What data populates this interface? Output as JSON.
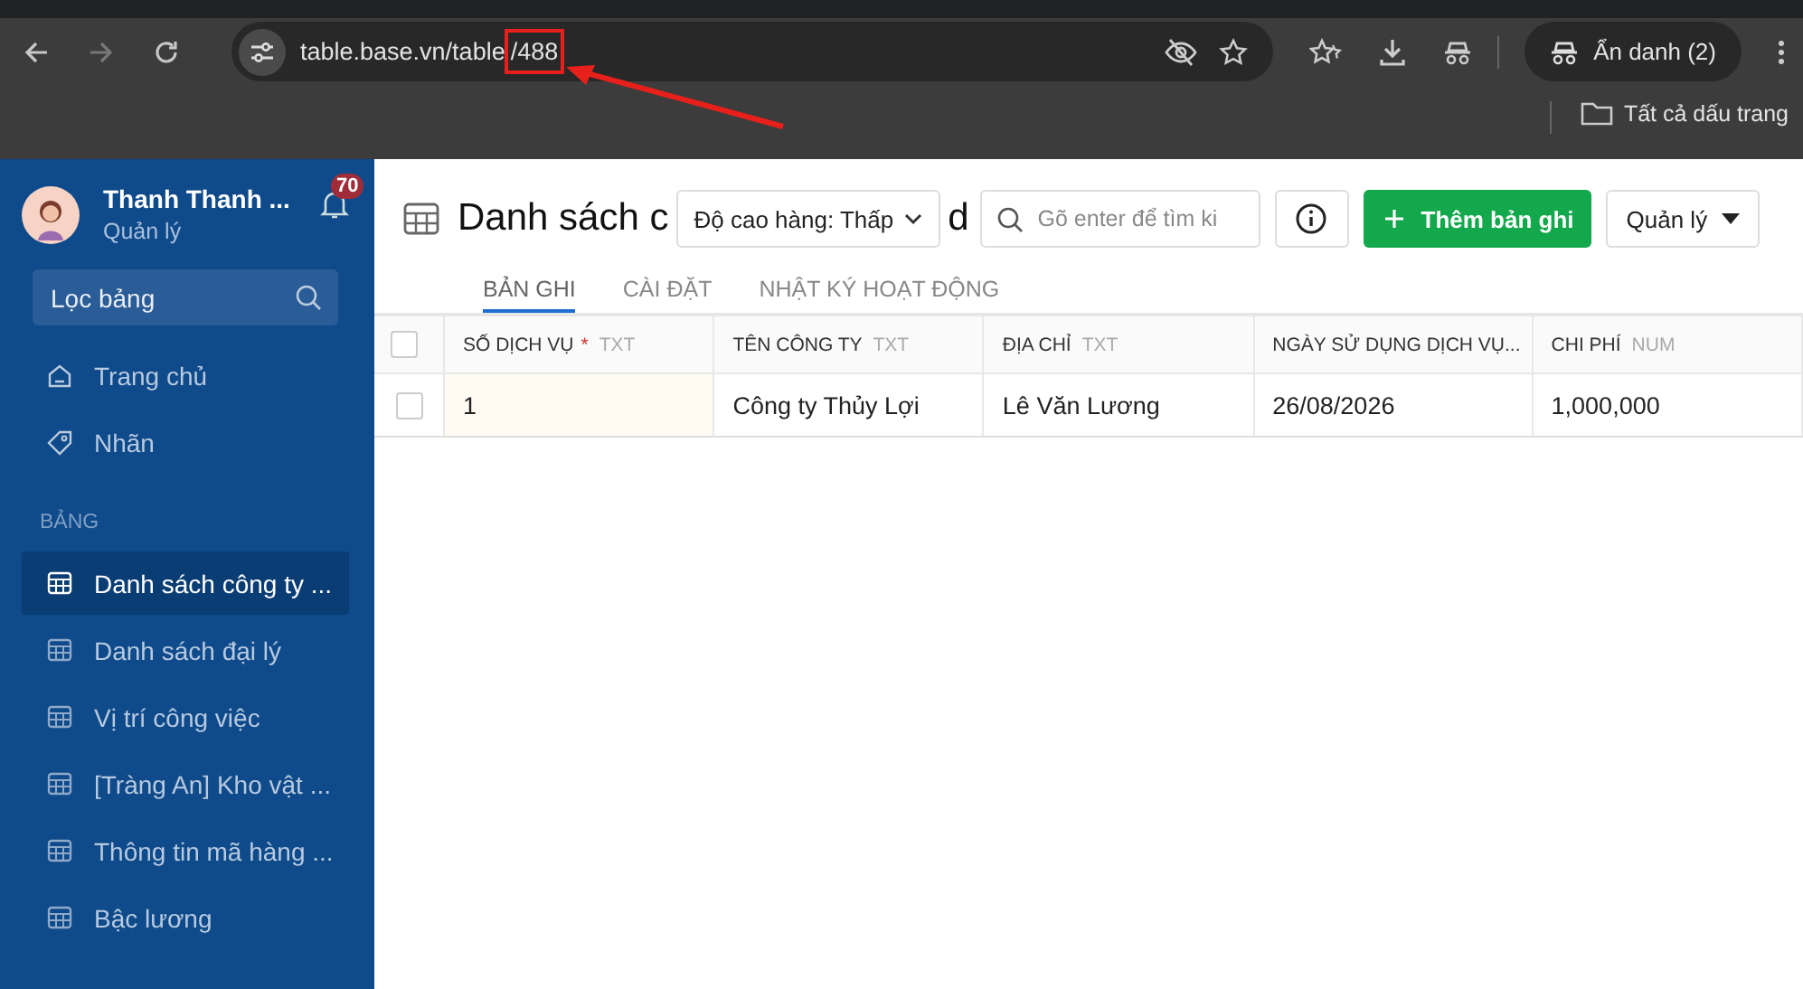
{
  "browser": {
    "url_start": "table.base.vn/table",
    "url_highlight": "/488",
    "profile_label": "Ẩn danh (2)",
    "bookmarks_folder": "Tất cả dấu trang"
  },
  "annotations": {
    "highlight_box": true,
    "arrow": true
  },
  "sidebar": {
    "user_name": "Thanh Thanh ...",
    "user_role": "Quản lý",
    "notification_count": "70",
    "filter_placeholder": "Lọc bảng",
    "nav": [
      {
        "kind": "home",
        "label": "Trang chủ"
      },
      {
        "kind": "tag",
        "label": "Nhãn"
      }
    ],
    "section_title": "BẢNG",
    "tables": [
      {
        "label": "Danh sách công ty ...",
        "selected": true
      },
      {
        "label": "Danh sách đại lý",
        "selected": false
      },
      {
        "label": "Vị trí công việc",
        "selected": false
      },
      {
        "label": "[Tràng An] Kho vật ...",
        "selected": false
      },
      {
        "label": "Thông tin mã hàng ...",
        "selected": false
      },
      {
        "label": "Bậc lương",
        "selected": false
      }
    ]
  },
  "header": {
    "title_start": "Danh sách c",
    "title_end": "d",
    "row_height": "Độ cao hàng: Thấp",
    "search_placeholder": "Gõ enter để tìm ki",
    "add_button": "Thêm bản ghi",
    "manage_button": "Quản lý",
    "tabs": [
      {
        "label": "BẢN GHI",
        "selected": true
      },
      {
        "label": "CÀI ĐẶT",
        "selected": false
      },
      {
        "label": "NHẬT KÝ HOẠT ĐỘNG",
        "selected": false
      }
    ]
  },
  "table": {
    "all_checked": false,
    "columns": [
      {
        "name": "SỐ DỊCH VỤ",
        "required_mark": "*",
        "type": "TXT"
      },
      {
        "name": "TÊN CÔNG TY",
        "type": "TXT"
      },
      {
        "name": "ĐỊA CHỈ",
        "type": "TXT"
      },
      {
        "name": "NGÀY SỬ DỤNG DỊCH VỤ..."
      },
      {
        "name": "CHI PHÍ",
        "type": "NUM"
      }
    ],
    "rows": [
      {
        "checked": false,
        "cells": [
          "1",
          "Công ty Thủy Lợi",
          "Lê Văn Lương",
          "26/08/2026",
          "1,000,000"
        ]
      }
    ]
  }
}
